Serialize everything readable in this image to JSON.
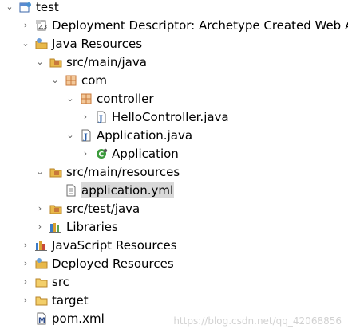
{
  "tree": {
    "items": [
      {
        "label": "test"
      },
      {
        "label": "Deployment Descriptor: Archetype Created Web A"
      },
      {
        "label": "Java Resources"
      },
      {
        "label": "src/main/java"
      },
      {
        "label": "com"
      },
      {
        "label": "controller"
      },
      {
        "label": "HelloController.java"
      },
      {
        "label": "Application.java"
      },
      {
        "label": "Application"
      },
      {
        "label": "src/main/resources"
      },
      {
        "label": "application.yml"
      },
      {
        "label": "src/test/java"
      },
      {
        "label": "Libraries"
      },
      {
        "label": "JavaScript Resources"
      },
      {
        "label": "Deployed Resources"
      },
      {
        "label": "src"
      },
      {
        "label": "target"
      },
      {
        "label": "pom.xml"
      }
    ],
    "selected_item": "application.yml"
  },
  "watermark": "https://blog.csdn.net/qq_42068856",
  "colors": {
    "selection_bg": "#d9d9d9",
    "folder": "#e8b84a",
    "package": "#c8783a",
    "java_file": "#2b5fa8",
    "class": "#3c9b3c"
  }
}
